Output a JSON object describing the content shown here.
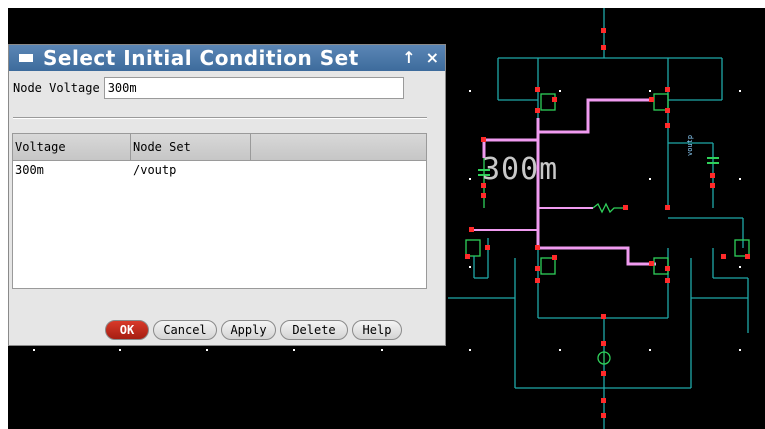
{
  "dialog": {
    "title": "Select Initial Condition Set",
    "title_buttons": [
      "↑",
      "×"
    ],
    "node_voltage_label": "Node Voltage",
    "node_voltage_value": "300m",
    "table": {
      "columns": [
        "Voltage",
        "Node Set"
      ],
      "rows": [
        {
          "voltage": "300m",
          "node_set": "/voutp"
        }
      ]
    },
    "buttons": {
      "ok": "OK",
      "cancel": "Cancel",
      "apply": "Apply",
      "delete": "Delete",
      "help": "Help"
    }
  },
  "schematic": {
    "annotation_label": "300m",
    "net_label": "voutp",
    "colors": {
      "background": "#000000",
      "wire": "#1fa8a8",
      "highlight": "#f09bf0",
      "pin": "#ff2a2a",
      "component": "#2fd05a",
      "text": "#c8c8c8"
    }
  }
}
